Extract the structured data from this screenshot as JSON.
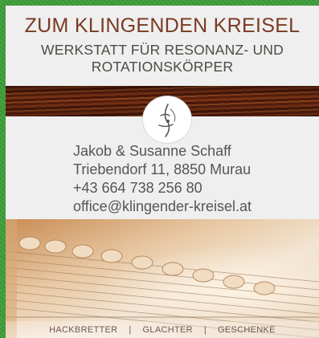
{
  "header": {
    "title": "ZUM KLINGENDEN KREISEL",
    "subtitle_line1": "WERKSTATT FÜR RESONANZ- UND",
    "subtitle_line2": "ROTATIONSKÖRPER"
  },
  "contact": {
    "names": "Jakob & Susanne Schaff",
    "address": "Triebendorf 11, 8850 Murau",
    "phone": "+43 664 738 256 80",
    "email": "office@klingender-kreisel.at"
  },
  "nav": {
    "items": [
      "HACKBRETTER",
      "GLACHTER",
      "GESCHENKE"
    ],
    "separator": "|"
  },
  "colors": {
    "background": "#3f9a3c",
    "title": "#7a3a22",
    "text": "#555553"
  }
}
